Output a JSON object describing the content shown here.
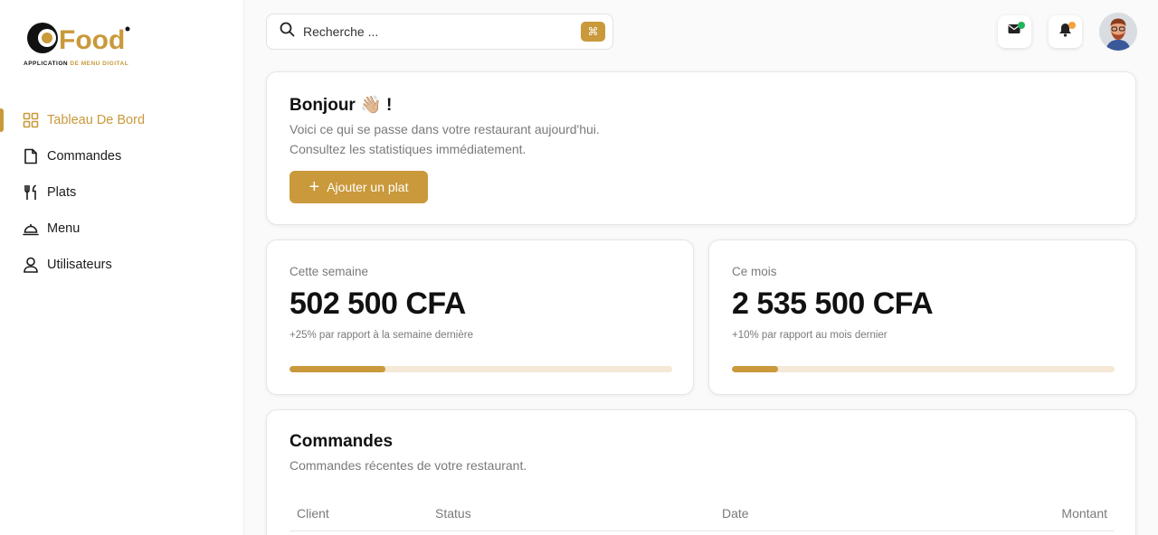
{
  "brand": {
    "logo_text": "Food",
    "tagline_part1": "APPLICATION",
    "tagline_part2": " DE MENU DIGITAL",
    "accent": "#c9993b"
  },
  "sidebar": {
    "items": [
      {
        "label": "Tableau De Bord",
        "icon": "dashboard-icon",
        "active": true
      },
      {
        "label": "Commandes",
        "icon": "document-icon",
        "active": false
      },
      {
        "label": "Plats",
        "icon": "utensils-icon",
        "active": false
      },
      {
        "label": "Menu",
        "icon": "cloche-icon",
        "active": false
      },
      {
        "label": "Utilisateurs",
        "icon": "user-icon",
        "active": false
      }
    ]
  },
  "header": {
    "search_placeholder": "Recherche ...",
    "search_shortcut": "⌘",
    "messages_status_color": "#22b35e",
    "notifications_status_color": "#f5a33a"
  },
  "welcome": {
    "title": "Bonjour 👋🏼 !",
    "description": "Voici ce qui se passe dans votre restaurant aujourd'hui. Consultez les statistiques immédiatement.",
    "add_button": "Ajouter un plat"
  },
  "stats": [
    {
      "label": "Cette semaine",
      "value": "502 500 CFA",
      "comparison": "+25% par rapport à la semaine dernière",
      "progress_fraction": 0.25
    },
    {
      "label": "Ce mois",
      "value": "2 535 500 CFA",
      "comparison": "+10% par rapport au mois dernier",
      "progress_fraction": 0.12
    }
  ],
  "orders": {
    "title": "Commandes",
    "subtitle": "Commandes récentes de votre restaurant.",
    "columns": [
      "Client",
      "Status",
      "Date",
      "Montant"
    ]
  }
}
